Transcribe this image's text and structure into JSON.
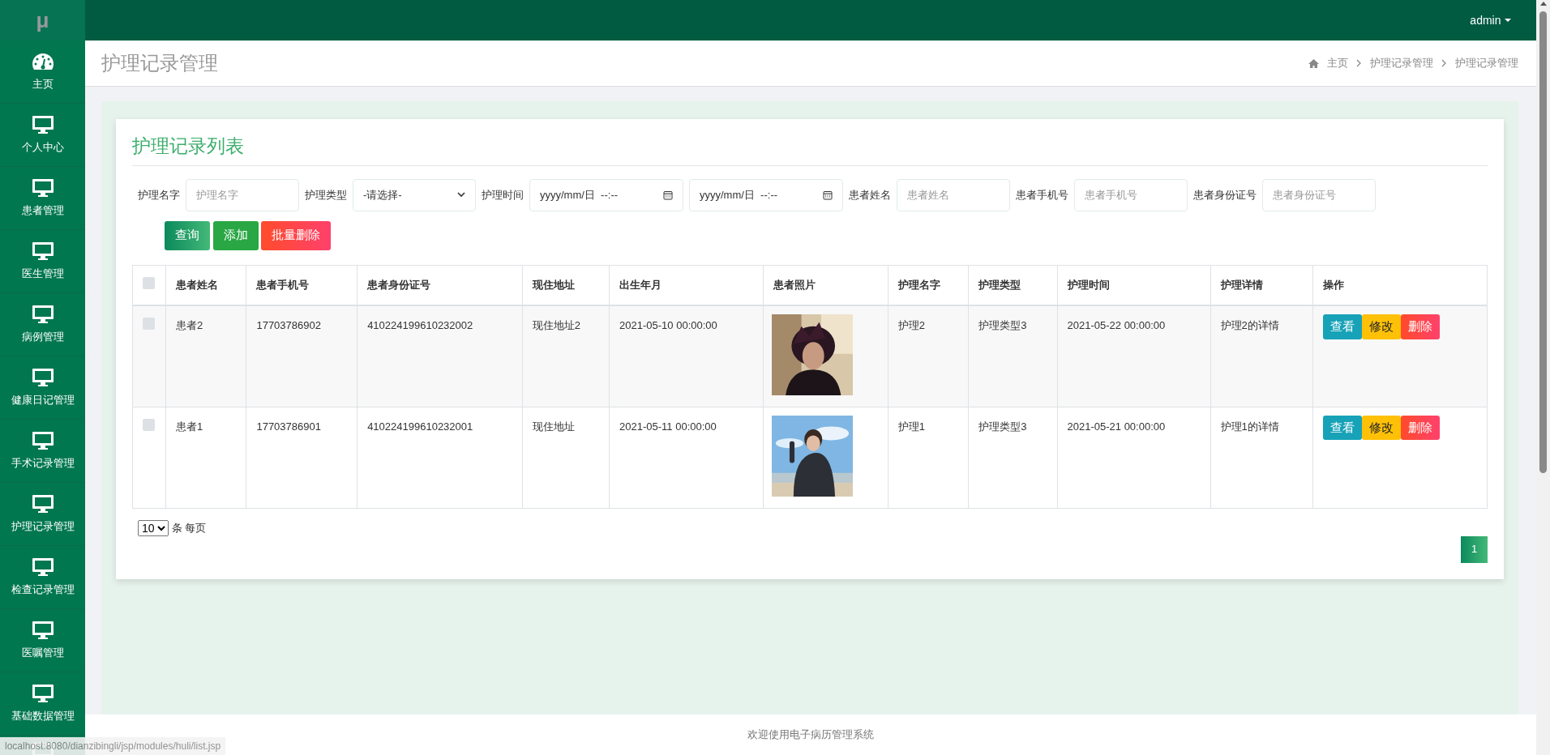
{
  "logo": "μ",
  "topbar": {
    "user": "admin"
  },
  "sidebar": {
    "items": [
      {
        "label": "主页",
        "kind": "dashboard",
        "selected": false
      },
      {
        "label": "个人中心",
        "kind": "monitor",
        "selected": false
      },
      {
        "label": "患者管理",
        "kind": "monitor",
        "selected": false
      },
      {
        "label": "医生管理",
        "kind": "monitor",
        "selected": false
      },
      {
        "label": "病例管理",
        "kind": "monitor",
        "selected": false
      },
      {
        "label": "健康日记管理",
        "kind": "monitor",
        "selected": false
      },
      {
        "label": "手术记录管理",
        "kind": "monitor",
        "selected": false
      },
      {
        "label": "护理记录管理",
        "kind": "monitor",
        "selected": false
      },
      {
        "label": "检查记录管理",
        "kind": "monitor",
        "selected": false
      },
      {
        "label": "医嘱管理",
        "kind": "monitor",
        "selected": false
      },
      {
        "label": "基础数据管理",
        "kind": "monitor",
        "selected": false
      }
    ]
  },
  "page_header": {
    "title": "护理记录管理",
    "breadcrumb": [
      "主页",
      "护理记录管理",
      "护理记录管理"
    ]
  },
  "card": {
    "title": "护理记录列表",
    "filters": [
      {
        "label": "护理名字",
        "kind": "text",
        "placeholder": "护理名字"
      },
      {
        "label": "护理类型",
        "kind": "select",
        "value": "-请选择-"
      },
      {
        "label": "护理时间",
        "kind": "datetime",
        "value": "yyyy/mm/日  --:--"
      },
      {
        "kind": "datetime",
        "value": "yyyy/mm/日  --:--"
      },
      {
        "label": "患者姓名",
        "kind": "text",
        "placeholder": "患者姓名"
      },
      {
        "label": "患者手机号",
        "kind": "text",
        "placeholder": "患者手机号"
      },
      {
        "label": "患者身份证号",
        "kind": "text",
        "placeholder": "患者身份证号"
      }
    ],
    "buttons": [
      {
        "label": "查询",
        "kind": "search"
      },
      {
        "label": "添加",
        "kind": "add"
      },
      {
        "label": "批量删除",
        "kind": "delete"
      }
    ],
    "table": {
      "columns": [
        "患者姓名",
        "患者手机号",
        "患者身份证号",
        "现住地址",
        "出生年月",
        "患者照片",
        "护理名字",
        "护理类型",
        "护理时间",
        "护理详情",
        "操作"
      ],
      "select_all_checked": false,
      "rows": [
        {
          "checked": false,
          "cells": [
            "患者2",
            "17703786902",
            "410224199610232002",
            "现住地址2",
            "2021-05-10 00:00:00"
          ],
          "photo": {
            "kind": "picture"
          },
          "cells2": [
            "护理2",
            "护理类型3",
            "2021-05-22 00:00:00",
            "护理2的详情"
          ],
          "actions": [
            {
              "label": "查看",
              "kind": "view"
            },
            {
              "label": "修改",
              "kind": "edit"
            },
            {
              "label": "删除",
              "kind": "delete"
            }
          ]
        },
        {
          "checked": false,
          "cells": [
            "患者1",
            "17703786901",
            "410224199610232001",
            "现住地址",
            "2021-05-11 00:00:00"
          ],
          "photo": {
            "kind": "picture"
          },
          "cells2": [
            "护理1",
            "护理类型3",
            "2021-05-21 00:00:00",
            "护理1的详情"
          ],
          "actions": [
            {
              "label": "查看",
              "kind": "view"
            },
            {
              "label": "修改",
              "kind": "edit"
            },
            {
              "label": "删除",
              "kind": "delete"
            }
          ]
        }
      ]
    },
    "page_size": {
      "value": "10",
      "suffix": "条 每页"
    },
    "pagination": [
      {
        "label": "1",
        "selected": true
      }
    ]
  },
  "footer": "欢迎使用电子病历管理系统",
  "status_url": "localhost:8080/dianzibingli/jsp/modules/huli/list.jsp"
}
